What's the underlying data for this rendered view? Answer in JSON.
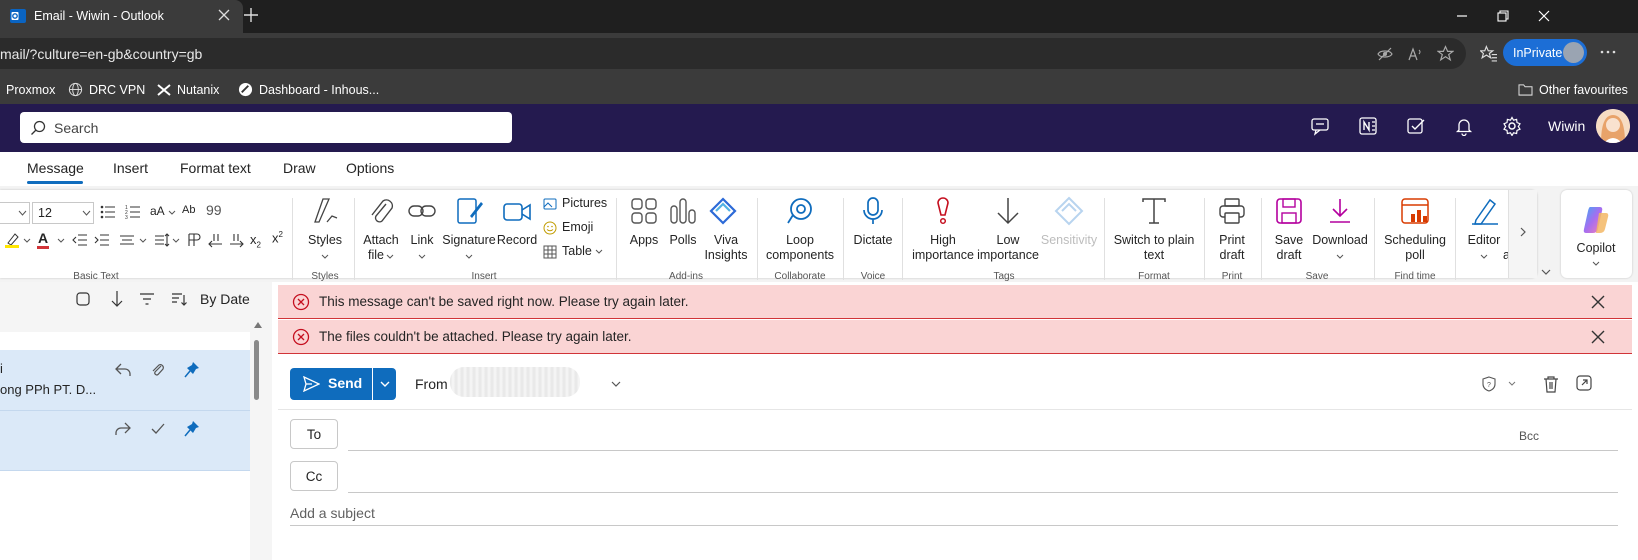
{
  "browser": {
    "tab_title": "Email - Wiwin - Outlook",
    "url": "mail/?culture=en-gb&country=gb",
    "inprivate_label": "InPrivate",
    "bookmarks": [
      "Proxmox",
      "DRC VPN",
      "Nutanix",
      "Dashboard - Inhous..."
    ],
    "other_favourites": "Other favourites"
  },
  "header": {
    "search_placeholder": "Search",
    "user_name": "Wiwin"
  },
  "ribbon_tabs": [
    "Message",
    "Insert",
    "Format text",
    "Draw",
    "Options"
  ],
  "ribbon": {
    "font_size": "12",
    "groups": {
      "basic_text": "Basic Text",
      "styles": "Styles",
      "insert": "Insert",
      "addins": "Add-ins",
      "collaborate": "Collaborate",
      "voice": "Voice",
      "tags": "Tags",
      "format": "Format",
      "print": "Print",
      "save": "Save",
      "find_time": "Find time"
    },
    "buttons": {
      "styles": "Styles",
      "attach_file_1": "Attach",
      "attach_file_2": "file",
      "link": "Link",
      "signature": "Signature",
      "record": "Record",
      "pictures": "Pictures",
      "emoji": "Emoji",
      "table": "Table",
      "apps": "Apps",
      "polls": "Polls",
      "viva_1": "Viva",
      "viva_2": "Insights",
      "loop_1": "Loop",
      "loop_2": "components",
      "dictate": "Dictate",
      "high_1": "High",
      "high_2": "importance",
      "low_1": "Low",
      "low_2": "importance",
      "sensitivity": "Sensitivity",
      "plain_1": "Switch to plain",
      "plain_2": "text",
      "print_1": "Print",
      "print_2": "draft",
      "save_1": "Save",
      "save_2": "draft",
      "download": "Download",
      "sched_1": "Scheduling",
      "sched_2": "poll",
      "editor": "Editor",
      "editor_trunc": "a",
      "copilot": "Copilot"
    }
  },
  "list_pane": {
    "sort_label": "By Date",
    "item1_line1": "i",
    "item1_line2": "ong PPh PT. D..."
  },
  "compose": {
    "errors": [
      "This message can't be saved right now. Please try again later.",
      "The files couldn't be attached. Please try again later."
    ],
    "send_label": "Send",
    "from_label": "From",
    "to_label": "To",
    "cc_label": "Cc",
    "bcc_label": "Bcc",
    "subject_placeholder": "Add a subject"
  },
  "colors": {
    "header_bg": "#241a4f",
    "accent": "#0f6cbd",
    "error_bg": "#fad4d4",
    "error_icon": "#c50f1f"
  }
}
